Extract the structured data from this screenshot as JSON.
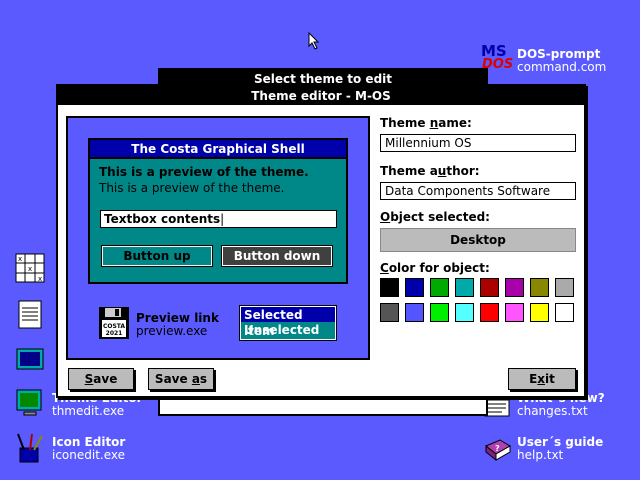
{
  "desktop": {
    "icons_right": [
      {
        "title": "DOS-prompt",
        "file": "command.com"
      },
      {
        "title": "What´s new?",
        "file": "changes.txt"
      },
      {
        "title": "User´s guide",
        "file": "help.txt"
      }
    ],
    "icons_left": [
      {
        "title": "Theme Editor",
        "file": "thmedit.exe"
      },
      {
        "title": "Icon Editor",
        "file": "iconedit.exe"
      }
    ],
    "msdos_logo": {
      "top": "MS",
      "bottom": "DOS"
    }
  },
  "back_dialog": {
    "title": "Select theme to edit"
  },
  "window": {
    "title": "Theme editor - M-OS",
    "preview": {
      "inner_title": "The Costa Graphical Shell",
      "text_selected": "This is a preview of the theme.",
      "text_normal": "This is a preview of the theme.",
      "textbox_value": "Textbox contents",
      "button_up": "Button up",
      "button_down": "Button down",
      "link_title": "Preview link",
      "link_file": "preview.exe",
      "floppy_label": "COSTA 2021",
      "list_selected": "Selected item",
      "list_unselected": "Unselected"
    },
    "theme_name_label": "Theme name:",
    "theme_name_value": "Millennium OS",
    "theme_author_label": "Theme author:",
    "theme_author_value": "Data Components Software",
    "object_label": "Object selected:",
    "object_value": "Desktop",
    "color_label": "Color for object:",
    "palette": [
      "#000000",
      "#0000aa",
      "#00aa00",
      "#00aaaa",
      "#aa0000",
      "#aa00aa",
      "#888800",
      "#aaaaaa",
      "#555555",
      "#5555ff",
      "#00ee00",
      "#55ffff",
      "#ff0000",
      "#ff55ff",
      "#ffff00",
      "#ffffff"
    ],
    "buttons": {
      "save": "Save",
      "save_as": "Save as",
      "exit": "Exit"
    }
  },
  "colors": {
    "desktop": "#5a5aff",
    "titlebar": "#000000",
    "accent": "#0000aa",
    "teal": "#008888"
  }
}
